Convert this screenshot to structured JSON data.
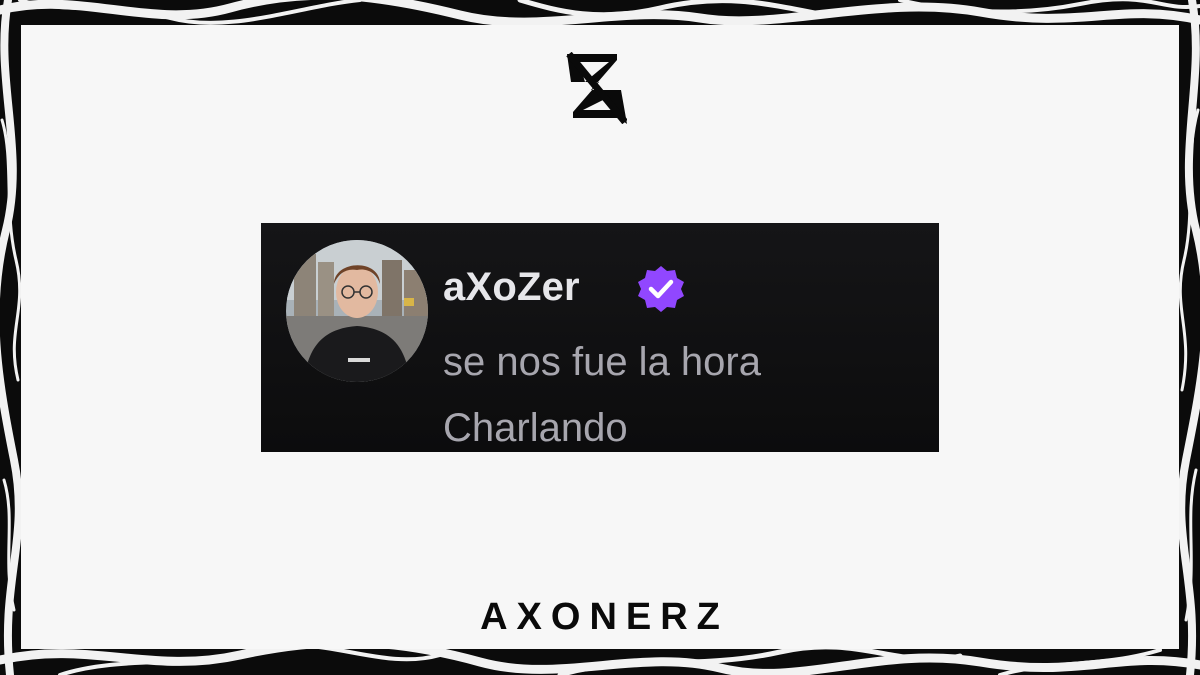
{
  "post": {
    "username": "aXoZer",
    "message_line_1": "se nos fue la hora",
    "message_line_2": "Charlando",
    "avatar_icon": "user-avatar-photo",
    "verified_icon": "verified-badge-icon",
    "verified_color": "#9147ff"
  },
  "branding": {
    "logo_icon": "axonerz-logo-icon",
    "name": "AXONERZ"
  },
  "colors": {
    "card_background": "#f7f7f7",
    "tweet_background": "#111113",
    "username_color": "#e6e6ea",
    "message_color": "#a7a6ae"
  }
}
